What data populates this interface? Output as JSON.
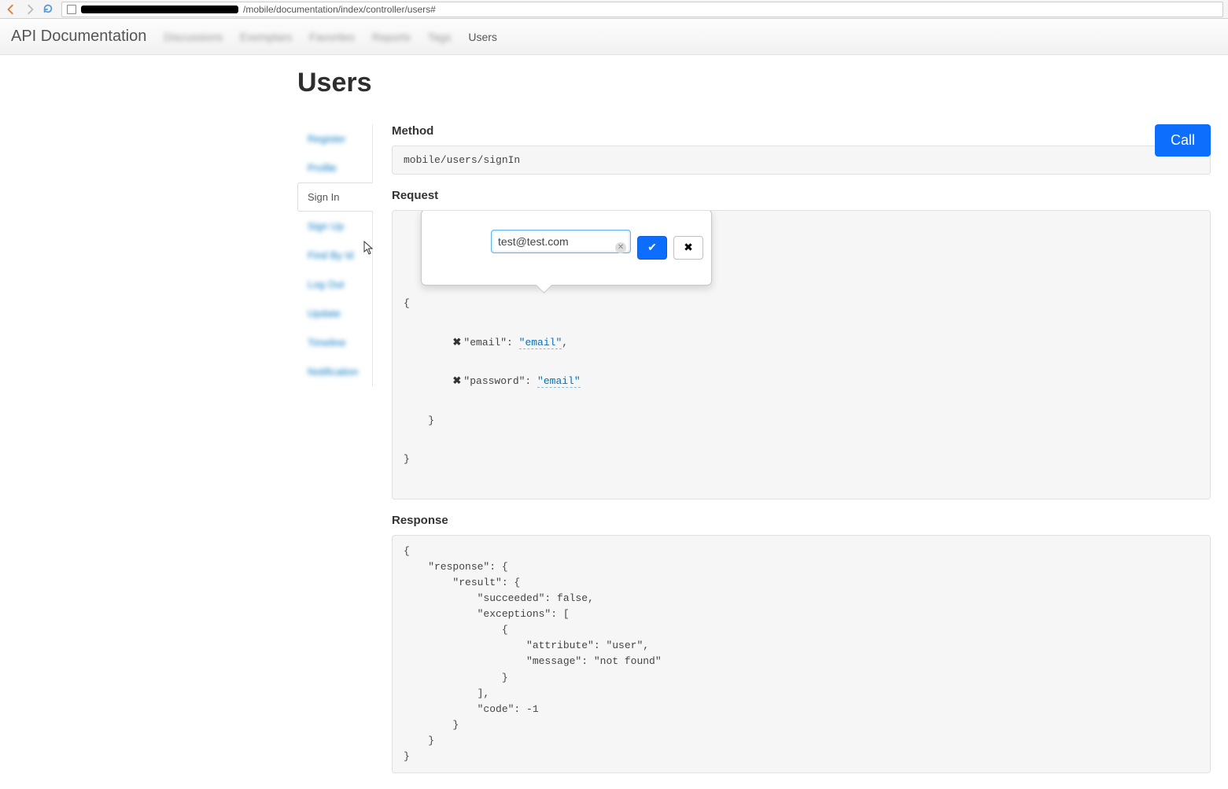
{
  "browser": {
    "url_visible_suffix": "/mobile/documentation/index/controller/users#"
  },
  "topnav": {
    "brand": "API Documentation",
    "items": [
      "Discussions",
      "Exemplars",
      "Favorites",
      "Reports",
      "Tags"
    ],
    "active": "Users"
  },
  "page": {
    "title": "Users",
    "call_button": "Call"
  },
  "sidebar": {
    "items": [
      {
        "label": "Register",
        "active": false
      },
      {
        "label": "Profile",
        "active": false
      },
      {
        "label": "Sign In",
        "active": true
      },
      {
        "label": "Sign Up",
        "active": false
      },
      {
        "label": "Find By Id",
        "active": false
      },
      {
        "label": "Log Out",
        "active": false
      },
      {
        "label": "Update",
        "active": false
      },
      {
        "label": "Timeline",
        "active": false
      },
      {
        "label": "Notification",
        "active": false
      }
    ]
  },
  "method": {
    "heading": "Method",
    "path": "mobile/users/signIn"
  },
  "request": {
    "heading": "Request",
    "popover_input_value": "test@test.com",
    "lines": {
      "open1": "{",
      "email_key": "\"email\": ",
      "email_val": "\"email\"",
      "comma": ",",
      "password_key": "\"password\": ",
      "password_val": "\"email\"",
      "close1": "    }",
      "close2": "}"
    }
  },
  "response": {
    "heading": "Response",
    "body": "{\n    \"response\": {\n        \"result\": {\n            \"succeeded\": false,\n            \"exceptions\": [\n                {\n                    \"attribute\": \"user\",\n                    \"message\": \"not found\"\n                }\n            ],\n            \"code\": -1\n        }\n    }\n}"
  }
}
